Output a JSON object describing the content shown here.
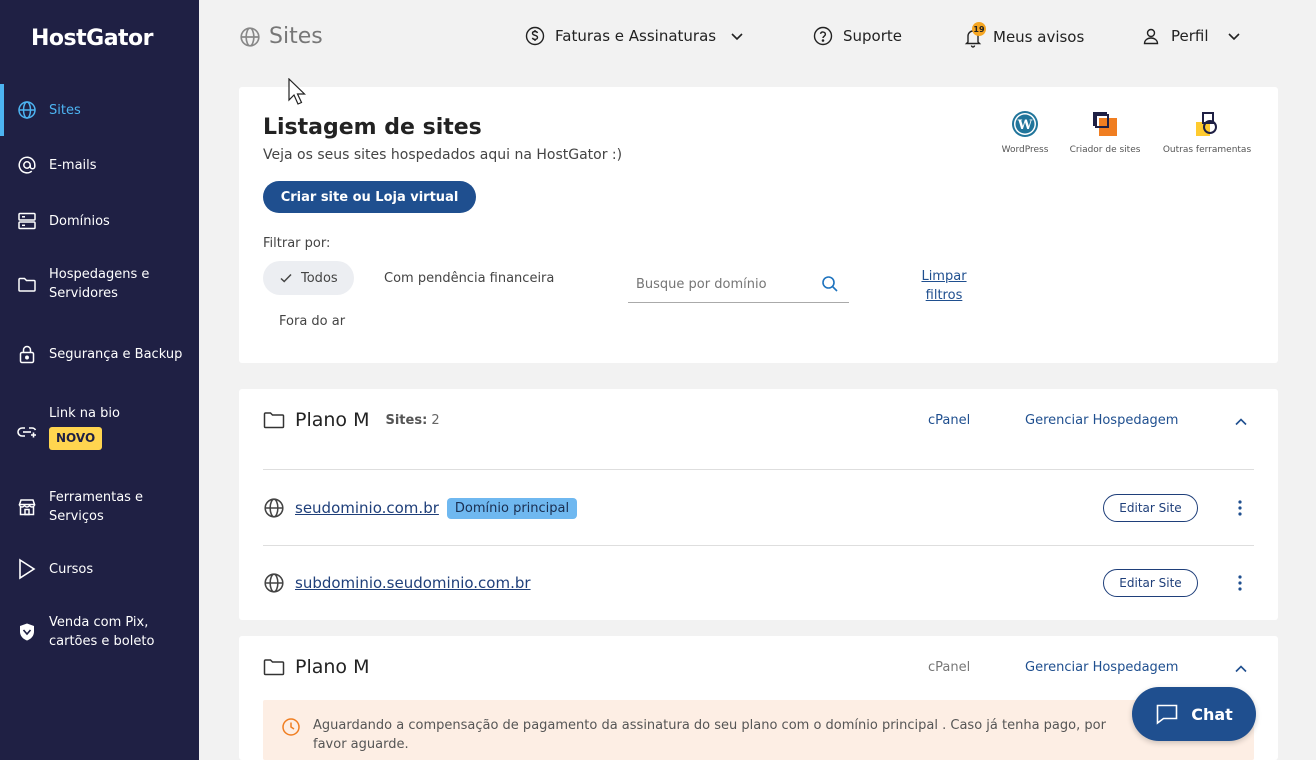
{
  "brand": {
    "name": "HostGator"
  },
  "sidebar": {
    "items": [
      {
        "label": "Sites",
        "icon": "globe-icon"
      },
      {
        "label": "E-mails",
        "icon": "at-icon"
      },
      {
        "label": "Domínios",
        "icon": "server-icon"
      },
      {
        "label": "Hospedagens e Servidores",
        "icon": "folder-icon"
      },
      {
        "label": "Segurança e Backup",
        "icon": "lock-icon"
      },
      {
        "label": "Link na bio",
        "icon": "link-icon",
        "badge": "NOVO"
      },
      {
        "label": "Ferramentas e Serviços",
        "icon": "store-icon"
      },
      {
        "label": "Cursos",
        "icon": "play-icon"
      },
      {
        "label": "Venda com Pix, cartões e boleto",
        "icon": "shield-icon"
      }
    ]
  },
  "header": {
    "title": "Sites",
    "billing": "Faturas e Assinaturas",
    "support": "Suporte",
    "notices": "Meus avisos",
    "notices_count": "19",
    "profile": "Perfil"
  },
  "listing": {
    "title": "Listagem de sites",
    "subtitle": "Veja os seus sites hospedados aqui na HostGator :)",
    "create_button": "Criar site ou Loja virtual",
    "filter_label": "Filtrar por:",
    "filters": [
      "Todos",
      "Com pendência financeira",
      "Fora do ar"
    ],
    "search_placeholder": "Busque por domínio",
    "clear_filters": "Limpar filtros",
    "tools": [
      "WordPress",
      "Criador de sites",
      "Outras ferramentas"
    ]
  },
  "plans": [
    {
      "name": "Plano M",
      "sites_label": "Sites:",
      "sites_count": "2",
      "cpanel": "cPanel",
      "manage": "Gerenciar Hospedagem",
      "sites": [
        {
          "domain": "seudominio.com.br",
          "tag": "Domínio principal",
          "edit": "Editar Site"
        },
        {
          "domain": "subdominio.seudominio.com.br",
          "edit": "Editar Site"
        }
      ]
    },
    {
      "name": "Plano M",
      "cpanel": "cPanel",
      "manage": "Gerenciar Hospedagem",
      "alert": "Aguardando a compensação de pagamento da assinatura do seu plano com o domínio principal . Caso já tenha pago, por favor aguarde."
    }
  ],
  "chat": {
    "label": "Chat"
  },
  "colors": {
    "sidebar": "#1f2044",
    "accent": "#4db4f2",
    "primary": "#1f4f8f",
    "badge": "#ffd54f",
    "alert_bg": "#fdeee4"
  }
}
